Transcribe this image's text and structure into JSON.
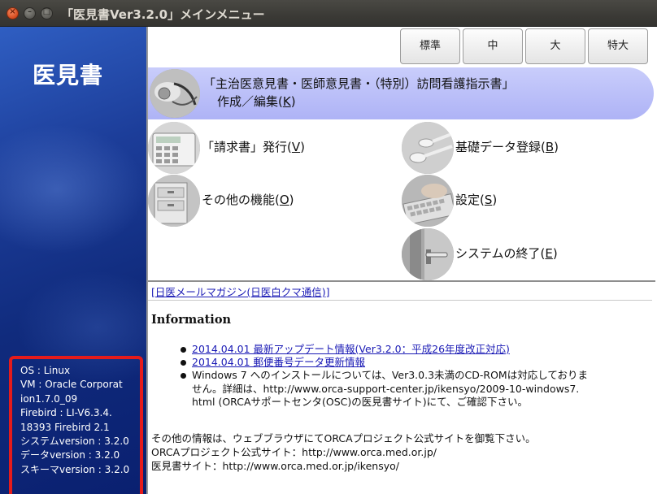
{
  "window": {
    "title": "「医見書Ver3.2.0」メインメニュー",
    "close_glyph": "×",
    "minimize_glyph": "–",
    "maximize_glyph": "□"
  },
  "sidebar": {
    "logo": "医見書",
    "system_info": [
      "OS : Linux",
      "VM : Oracle Corporat",
      "ion1.7.0_09",
      "Firebird : LI-V6.3.4.",
      "18393 Firebird 2.1",
      "システムversion : 3.2.0",
      "データversion : 3.2.0",
      "スキーマversion : 3.2.0"
    ]
  },
  "size_buttons": [
    "標準",
    "中",
    "大",
    "特大"
  ],
  "banner": {
    "line1": "「主治医意見書・医師意見書・（特別）訪問看護指示書」",
    "line2_prefix": "作成／編集(",
    "line2_key": "K",
    "line2_suffix": ")"
  },
  "menu": {
    "invoice": {
      "prefix": "「請求書」発行(",
      "key": "V",
      "suffix": ")"
    },
    "basic_data": {
      "prefix": "基礎データ登録(",
      "key": "B",
      "suffix": ")"
    },
    "other": {
      "prefix": "その他の機能(",
      "key": "O",
      "suffix": ")"
    },
    "settings": {
      "prefix": "設定(",
      "key": "S",
      "suffix": ")"
    },
    "exit": {
      "prefix": "システムの終了(",
      "key": "E",
      "suffix": ")"
    }
  },
  "info": {
    "mail_link": "[日医メールマガジン(日医白クマ通信)]",
    "heading": "Information",
    "links": [
      "2014.04.01 最新アップデート情報(Ver3.2.0：平成26年度改正対応)",
      "2014.04.01 郵便番号データ更新情報"
    ],
    "notice_lines": [
      "Windows 7 へのインストールについては、Ver3.0.3未満のCD-ROMは対応しておりま",
      "せん。詳細は、http://www.orca-support-center.jp/ikensyo/2009-10-windows7.",
      "html (ORCAサポートセンタ(OSC)の医見書サイト)にて、ご確認下さい。"
    ],
    "footer": [
      "その他の情報は、ウェブブラウザにてORCAプロジェクト公式サイトを御覧下さい。",
      "ORCAプロジェクト公式サイト：http://www.orca.med.or.jp/",
      "医見書サイト：http://www.orca.med.or.jp/ikensyo/"
    ]
  },
  "colors": {
    "sidebar_blue": "#1c3d99",
    "highlight_red": "#e51b1b",
    "banner_lavender": "#b4b9f7",
    "link_blue": "#1a1ab5"
  }
}
